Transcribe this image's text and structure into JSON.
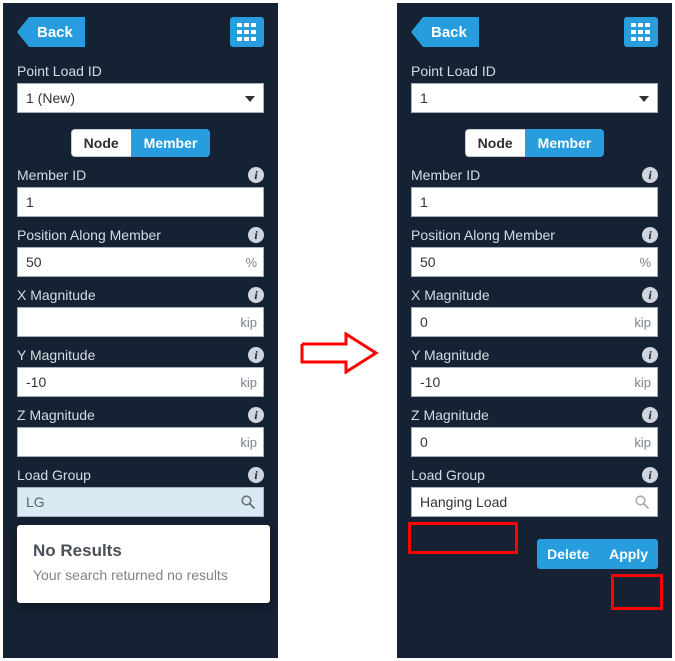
{
  "left": {
    "back_label": "Back",
    "heading_point_load_id": "Point Load ID",
    "point_load_id_value": "1 (New)",
    "toggle_node": "Node",
    "toggle_member": "Member",
    "heading_member_id": "Member ID",
    "member_id_value": "1",
    "heading_position": "Position Along Member",
    "position_value": "50",
    "position_unit": "%",
    "heading_xmag": "X Magnitude",
    "xmag_value": "",
    "xmag_unit": "kip",
    "heading_ymag": "Y Magnitude",
    "ymag_value": "-10",
    "ymag_unit": "kip",
    "heading_zmag": "Z Magnitude",
    "zmag_value": "",
    "zmag_unit": "kip",
    "heading_load_group": "Load Group",
    "load_group_value": "LG",
    "popup_title": "No Results",
    "popup_text": "Your search returned no results"
  },
  "right": {
    "back_label": "Back",
    "heading_point_load_id": "Point Load ID",
    "point_load_id_value": "1",
    "toggle_node": "Node",
    "toggle_member": "Member",
    "heading_member_id": "Member ID",
    "member_id_value": "1",
    "heading_position": "Position Along Member",
    "position_value": "50",
    "position_unit": "%",
    "heading_xmag": "X Magnitude",
    "xmag_value": "0",
    "xmag_unit": "kip",
    "heading_ymag": "Y Magnitude",
    "ymag_value": "-10",
    "ymag_unit": "kip",
    "heading_zmag": "Z Magnitude",
    "zmag_value": "0",
    "zmag_unit": "kip",
    "heading_load_group": "Load Group",
    "load_group_value": "Hanging Load",
    "delete_label": "Delete",
    "apply_label": "Apply"
  }
}
